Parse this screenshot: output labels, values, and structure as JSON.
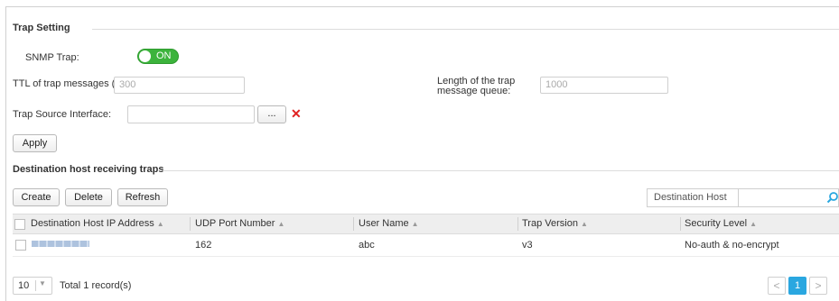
{
  "trap_setting": {
    "section_title": "Trap Setting",
    "snmp_trap_label": "SNMP Trap:",
    "snmp_trap_state": "ON",
    "ttl_label": "TTL of trap messages (s):",
    "ttl_placeholder": "300",
    "queue_label_line1": "Length of the trap",
    "queue_label_line2": "message queue:",
    "queue_placeholder": "1000",
    "source_interface_label": "Trap Source Interface:",
    "source_interface_value": "",
    "browse_label": "...",
    "apply_label": "Apply"
  },
  "destination": {
    "section_title": "Destination host receiving traps",
    "toolbar": {
      "create_label": "Create",
      "delete_label": "Delete",
      "refresh_label": "Refresh",
      "search_placeholder": "Destination Host",
      "search_value": ""
    },
    "columns": [
      "Destination Host IP Address",
      "UDP Port Number",
      "User Name",
      "Trap Version",
      "Security Level"
    ],
    "rows": [
      {
        "ip": "",
        "udp_port": "162",
        "user_name": "abc",
        "trap_version": "v3",
        "security_level": "No-auth & no-encrypt"
      }
    ],
    "pager": {
      "page_size": "10",
      "total_text": "Total 1 record(s)",
      "prev": "<",
      "current_page": "1",
      "next": ">"
    }
  },
  "colors": {
    "toggle_on": "#3cb33c",
    "accent": "#2aa7e0",
    "clear_icon": "#e02020"
  }
}
